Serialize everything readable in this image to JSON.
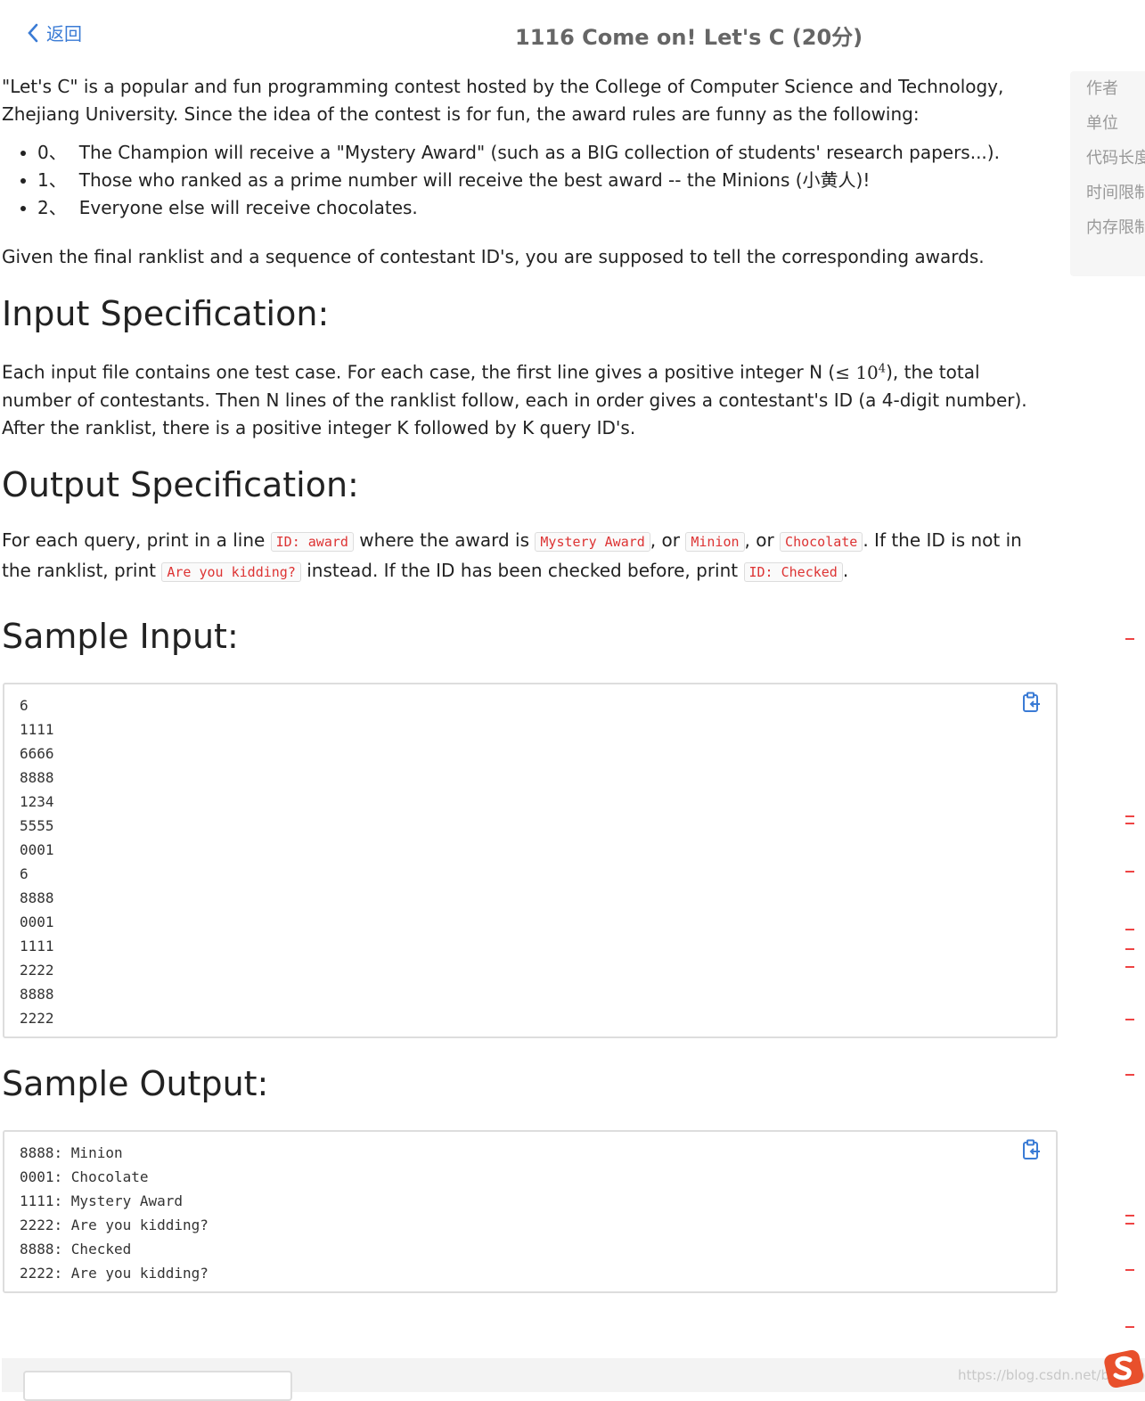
{
  "header": {
    "back_label": "返回",
    "title": "1116 Come on! Let's C (20分)"
  },
  "intro": {
    "paragraph1": "\"Let's C\" is a popular and fun programming contest hosted by the College of Computer Science and Technology, Zhejiang University. Since the idea of the contest is for fun, the award rules are funny as the following:",
    "rules": [
      {
        "num": "0、",
        "text": "The Champion will receive a \"Mystery Award\" (such as a BIG collection of students' research papers...)."
      },
      {
        "num": "1、",
        "text": "Those who ranked as a prime number will receive the best award -- the Minions (小黄人)!"
      },
      {
        "num": "2、",
        "text": "Everyone else will receive chocolates."
      }
    ],
    "paragraph2": "Given the final ranklist and a sequence of contestant ID's, you are supposed to tell the corresponding awards."
  },
  "input_spec": {
    "heading": "Input Specification:",
    "text_a": "Each input file contains one test case. For each case, the first line gives a positive integer N (",
    "math": "≤ 10",
    "math_sup": "4",
    "text_b": "), the total number of contestants. Then N lines of the ranklist follow, each in order gives a contestant's ID (a 4-digit number). After the ranklist, there is a positive integer K followed by K query ID's."
  },
  "output_spec": {
    "heading": "Output Specification:",
    "t1": "For each query, print in a line ",
    "c1": "ID: award",
    "t2": " where the award is ",
    "c2": "Mystery Award",
    "t3": ", or ",
    "c3": "Minion",
    "t4": ", or ",
    "c4": "Chocolate",
    "t5": ". If the ID is not in the ranklist, print ",
    "c5": "Are you kidding?",
    "t6": " instead. If the ID has been checked before, print ",
    "c6": "ID: Checked",
    "t7": "."
  },
  "sample_input": {
    "heading": "Sample Input:",
    "lines": [
      "6",
      "1111",
      "6666",
      "8888",
      "1234",
      "5555",
      "0001",
      "6",
      "8888",
      "0001",
      "1111",
      "2222",
      "8888",
      "2222"
    ]
  },
  "sample_output": {
    "heading": "Sample Output:",
    "lines": [
      "8888: Minion",
      "0001: Chocolate",
      "1111: Mystery Award",
      "2222: Are you kidding?",
      "8888: Checked",
      "2222: Are you kidding?"
    ]
  },
  "sidebar": {
    "labels": [
      "作者",
      "单位",
      "代码长度",
      "时间限制",
      "内存限制"
    ]
  },
  "watermark": "https://blog.csdn.net/bbwxbb",
  "colors": {
    "link": "#3a7bd5",
    "code_text": "#dd3333",
    "logo": "#e8502c"
  }
}
